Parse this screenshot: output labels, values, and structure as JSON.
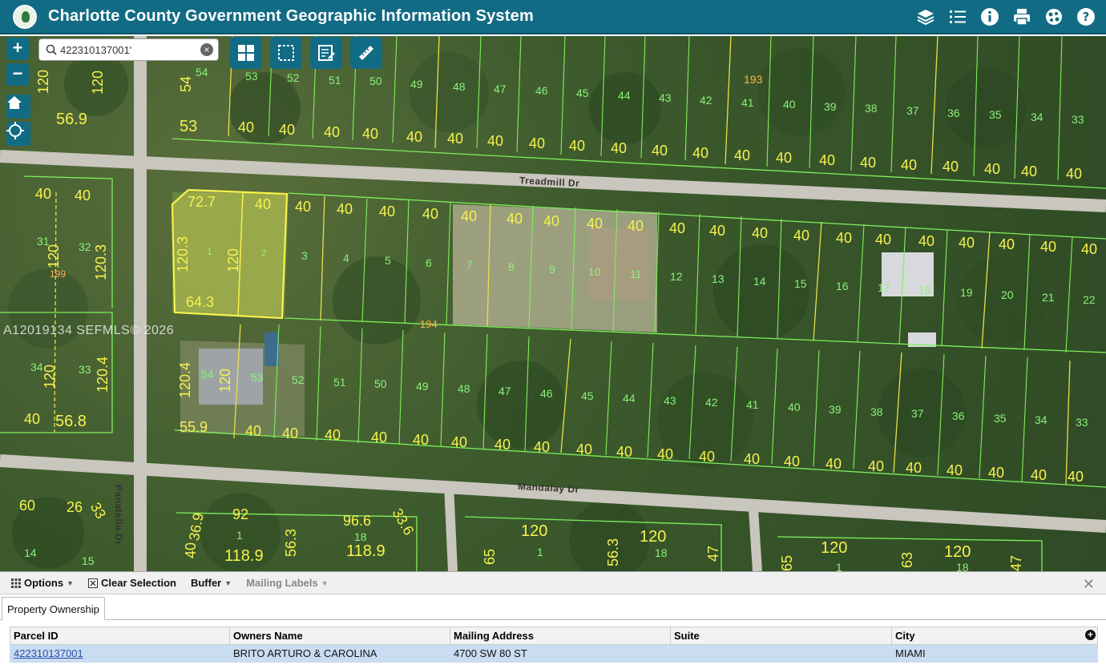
{
  "header": {
    "title": "Charlotte County Government Geographic Information System",
    "icons": [
      "layers-icon",
      "legend-list-icon",
      "info-icon",
      "print-icon",
      "tools-icon",
      "help-icon"
    ]
  },
  "search": {
    "value": "422310137001'"
  },
  "map": {
    "watermark": "A12019134 SEFMLS© 2026",
    "streets": [
      "Treadmill Dr",
      "Mandalay Dr",
      "Panatella Dr"
    ],
    "zoom_in": "+",
    "zoom_out": "−",
    "row1_lots": [
      "54",
      "53",
      "52",
      "51",
      "50",
      "49",
      "48",
      "47",
      "46",
      "45",
      "44",
      "43",
      "42",
      "41",
      "40",
      "39",
      "38",
      "37",
      "36",
      "35",
      "34",
      "33"
    ],
    "row1_block": "193",
    "row2_lots": [
      "3",
      "4",
      "5",
      "6",
      "7",
      "8",
      "9",
      "10",
      "11",
      "12",
      "13",
      "14",
      "15",
      "16",
      "17",
      "18",
      "19",
      "20",
      "21",
      "22"
    ],
    "row3_lots": [
      "52",
      "51",
      "50",
      "49",
      "48",
      "47",
      "46",
      "45",
      "44",
      "43",
      "42",
      "41",
      "40",
      "39",
      "38",
      "37",
      "36",
      "35",
      "34",
      "33"
    ],
    "block_194": "194",
    "block_199": "199",
    "selected_lots": [
      "1",
      "2"
    ],
    "dims": {
      "sel_top": "72.7",
      "sel_left": "120.3",
      "sel_mid": "120",
      "sel_bottom": "64.3",
      "lot_w": "40",
      "left_lots_top": [
        "40",
        "40"
      ],
      "left_lot_nums": [
        "31",
        "32",
        "34",
        "33"
      ],
      "left_dims": [
        "120",
        "120.3",
        "120",
        "120.4",
        "56.8",
        "40",
        "56.9",
        "120",
        "120",
        "54",
        "53"
      ],
      "row3_left": [
        "54",
        "53",
        "120.4",
        "120",
        "55.9"
      ],
      "bottom_dims": [
        "60",
        "26",
        "33",
        "36.9",
        "92",
        "96.6",
        "33.6",
        "118.9",
        "118.9",
        "56.3",
        "40",
        "120",
        "65",
        "56.3",
        "120",
        "47",
        "120",
        "63",
        "120",
        "65",
        "47"
      ],
      "bottom_lots": [
        "14",
        "15",
        "1",
        "18",
        "1",
        "18",
        "1",
        "18"
      ]
    }
  },
  "panel": {
    "toolbar": {
      "options": "Options",
      "clear_selection": "Clear Selection",
      "buffer": "Buffer",
      "mailing_labels": "Mailing Labels"
    },
    "tab": "Property Ownership",
    "columns": [
      "Parcel ID",
      "Owners Name",
      "Mailing Address",
      "Suite",
      "City"
    ],
    "rows": [
      [
        "422310137001",
        "BRITO ARTURO & CAROLINA",
        "4700 SW 80 ST",
        "",
        "MIAMI"
      ]
    ]
  }
}
